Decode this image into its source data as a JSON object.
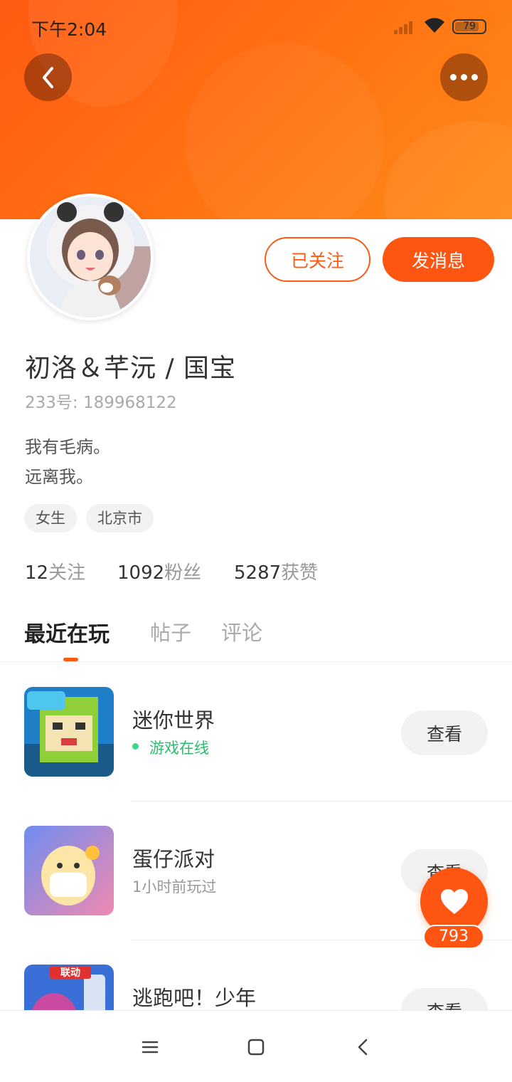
{
  "status_bar": {
    "time": "下午2:04",
    "battery": "79"
  },
  "header": {
    "back_icon": "chevron-left-icon",
    "more_icon": "more-dots-icon"
  },
  "profile": {
    "name": "初洛＆芊沅 / 国宝",
    "account_id": "233号: 189968122",
    "bio": [
      "我有毛病。",
      "远离我。"
    ],
    "tags": [
      "女生",
      "北京市"
    ],
    "follow_label": "已关注",
    "message_label": "发消息"
  },
  "stats": [
    {
      "value": "12",
      "label": "关注"
    },
    {
      "value": "1092",
      "label": "粉丝"
    },
    {
      "value": "5287",
      "label": "获赞"
    }
  ],
  "tabs": [
    "最近在玩",
    "帖子",
    "评论"
  ],
  "games": [
    {
      "title": "迷你世界",
      "status": "游戏在线",
      "online": true,
      "view_label": "查看"
    },
    {
      "title": "蛋仔派对",
      "status": "1小时前玩过",
      "online": false,
      "view_label": "查看"
    },
    {
      "title": "逃跑吧！少年",
      "status": "",
      "online": false,
      "view_label": "查看",
      "icon_badge": "联动"
    }
  ],
  "like": {
    "count": "793"
  },
  "colors": {
    "accent": "#ff5512",
    "online": "#2dbb6e"
  }
}
